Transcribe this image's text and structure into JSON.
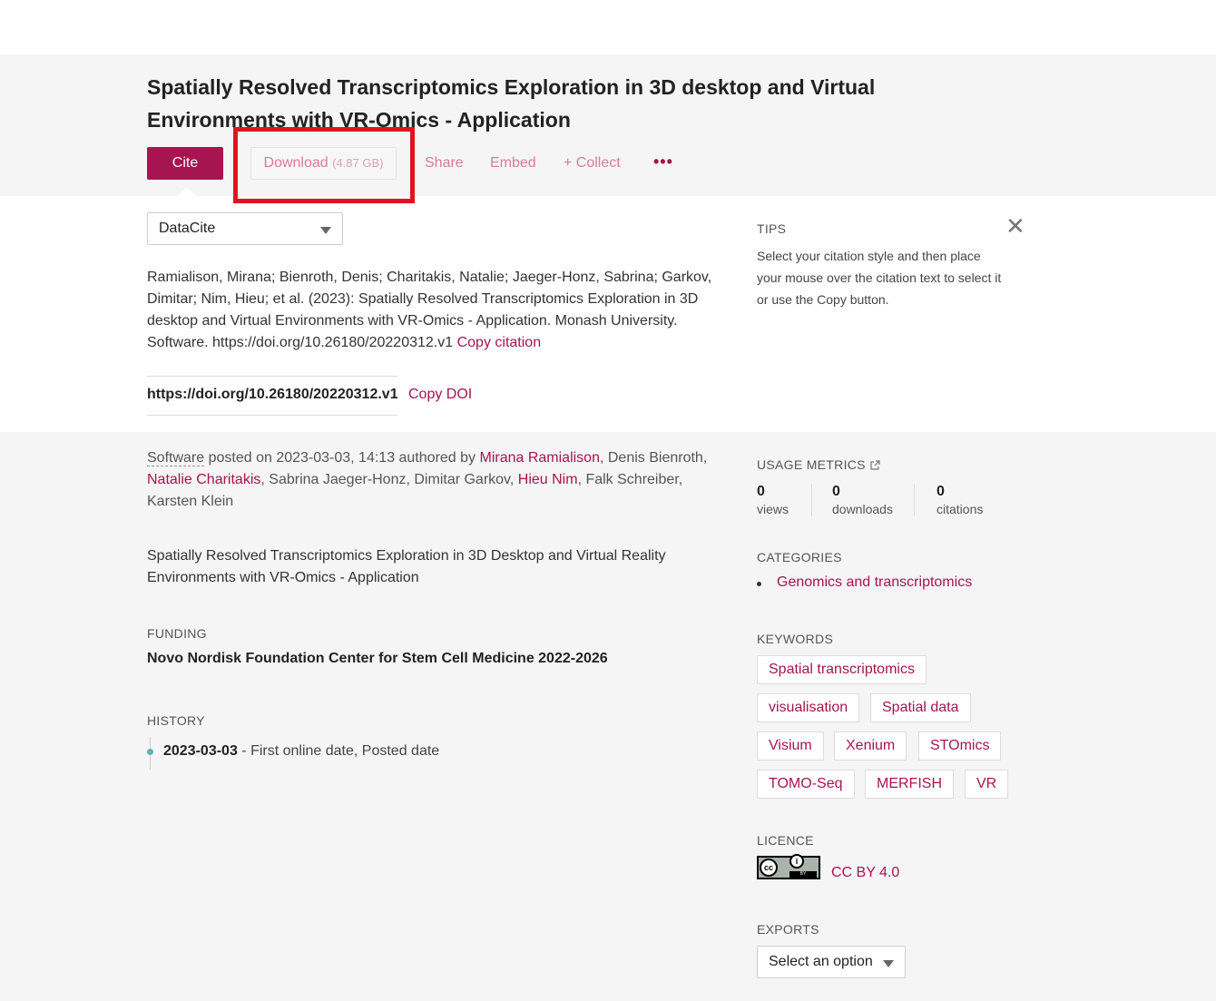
{
  "title": "Spatially Resolved Transcriptomics Exploration in 3D desktop and Virtual Environments with VR-Omics - Application",
  "actions": {
    "cite": "Cite",
    "download": "Download",
    "download_size": "(4.87 GB)",
    "share": "Share",
    "embed": "Embed",
    "collect": "+ Collect",
    "more": "•••"
  },
  "citation": {
    "style": "DataCite",
    "text": "Ramialison, Mirana; Bienroth, Denis; Charitakis, Natalie; Jaeger-Honz, Sabrina; Garkov, Dimitar; Nim, Hieu; et al. (2023): Spatially Resolved Transcriptomics Exploration in 3D desktop and Virtual Environments with VR-Omics - Application. Monash University. Software. https://doi.org/10.26180/20220312.v1",
    "copy_label": "Copy citation",
    "doi": "https://doi.org/10.26180/20220312.v1",
    "copy_doi_label": "Copy DOI"
  },
  "tips": {
    "heading": "TIPS",
    "body": "Select your citation style and then place your mouse over the citation text to select it or use the Copy button."
  },
  "meta": {
    "type": "Software",
    "posted": " posted on 2023-03-03, 14:13 authored by ",
    "authors": [
      {
        "name": "Mirana Ramialison",
        "link": true
      },
      {
        "name": "Denis Bienroth",
        "link": false
      },
      {
        "name": "Natalie Charitakis",
        "link": true
      },
      {
        "name": "Sabrina Jaeger-Honz",
        "link": false
      },
      {
        "name": "Dimitar Garkov",
        "link": false
      },
      {
        "name": "Hieu Nim",
        "link": true
      },
      {
        "name": "Falk Schreiber",
        "link": false
      },
      {
        "name": "Karsten Klein",
        "link": false
      }
    ]
  },
  "description": "Spatially Resolved Transcriptomics Exploration in 3D Desktop and Virtual Reality Environments with VR-Omics - Application",
  "funding": {
    "heading": "FUNDING",
    "item": "Novo Nordisk Foundation Center for Stem Cell Medicine 2022-2026"
  },
  "history": {
    "heading": "HISTORY",
    "date": "2023-03-03",
    "event": " - First online date, Posted date"
  },
  "metrics": {
    "heading": "USAGE METRICS",
    "views": "0",
    "views_label": "views",
    "downloads": "0",
    "downloads_label": "downloads",
    "citations": "0",
    "citations_label": "citations"
  },
  "categories": {
    "heading": "CATEGORIES",
    "items": [
      "Genomics and transcriptomics"
    ]
  },
  "keywords": {
    "heading": "KEYWORDS",
    "items": [
      "Spatial transcriptomics",
      "visualisation",
      "Spatial data",
      "Visium",
      "Xenium",
      "STOmics",
      "TOMO-Seq",
      "MERFISH",
      "VR"
    ]
  },
  "licence": {
    "heading": "LICENCE",
    "name": "CC BY 4.0",
    "badge_cc": "cc",
    "badge_i": "i",
    "badge_by": "BY"
  },
  "exports": {
    "heading": "EXPORTS",
    "placeholder": "Select an option"
  },
  "colors": {
    "accent": "#a6154f",
    "highlight": "#e0141e"
  }
}
